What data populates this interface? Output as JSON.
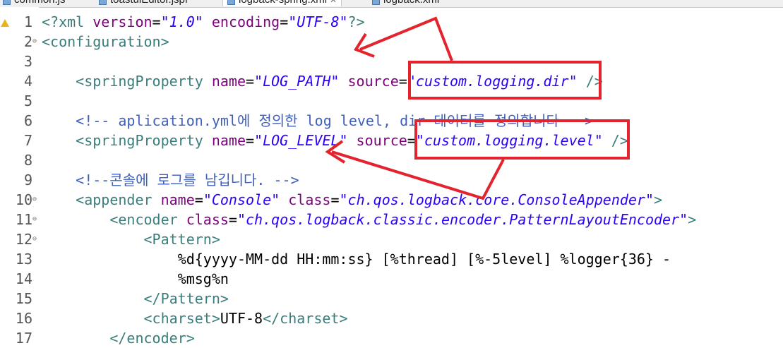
{
  "tabs": [
    {
      "label": "common.js",
      "active": false,
      "icon": "js-file-icon"
    },
    {
      "label": "toastuiEditor.jspf",
      "active": false,
      "icon": "jsp-file-icon"
    },
    {
      "label": "logback-spring.xml",
      "active": true,
      "icon": "xml-file-icon",
      "close": "✕"
    },
    {
      "label": "logback.xml",
      "active": false,
      "icon": "xml-file-icon"
    }
  ],
  "editor": {
    "warning_icon": "warning-icon",
    "lines": [
      {
        "num": "1",
        "fold": "",
        "segs": [
          [
            "tag",
            "<?xml "
          ],
          [
            "attr",
            "version"
          ],
          [
            "txt",
            "="
          ],
          [
            "val",
            "\"1.0\""
          ],
          [
            "txt",
            " "
          ],
          [
            "attr",
            "encoding"
          ],
          [
            "txt",
            "="
          ],
          [
            "val",
            "\"UTF-8\""
          ],
          [
            "tag",
            "?>"
          ]
        ]
      },
      {
        "num": "2",
        "fold": "⊖",
        "segs": [
          [
            "tag",
            "<configuration>"
          ]
        ]
      },
      {
        "num": "3",
        "fold": "",
        "segs": []
      },
      {
        "num": "4",
        "fold": "",
        "segs": [
          [
            "txt",
            "    "
          ],
          [
            "tag",
            "<springProperty "
          ],
          [
            "attr",
            "name"
          ],
          [
            "txt",
            "="
          ],
          [
            "val",
            "\"LOG_PATH\""
          ],
          [
            "txt",
            " "
          ],
          [
            "attr",
            "source"
          ],
          [
            "txt",
            "="
          ],
          [
            "val",
            "\"custom.logging.dir\""
          ],
          [
            "txt",
            " "
          ],
          [
            "tag",
            "/>"
          ]
        ]
      },
      {
        "num": "5",
        "fold": "",
        "segs": []
      },
      {
        "num": "6",
        "fold": "",
        "segs": [
          [
            "txt",
            "    "
          ],
          [
            "cm",
            "<!-- aplication.yml에 정의한 log level, dir 데이터를 정의합니다 -->"
          ]
        ]
      },
      {
        "num": "7",
        "fold": "",
        "segs": [
          [
            "txt",
            "    "
          ],
          [
            "tag",
            "<springProperty "
          ],
          [
            "attr",
            "name"
          ],
          [
            "txt",
            "="
          ],
          [
            "val",
            "\"LOG_LEVEL\""
          ],
          [
            "txt",
            " "
          ],
          [
            "attr",
            "source"
          ],
          [
            "txt",
            "="
          ],
          [
            "val",
            "\"custom.logging.level\""
          ],
          [
            "txt",
            " "
          ],
          [
            "tag",
            "/>"
          ]
        ]
      },
      {
        "num": "8",
        "fold": "",
        "segs": []
      },
      {
        "num": "9",
        "fold": "",
        "segs": [
          [
            "txt",
            "    "
          ],
          [
            "cm",
            "<!--콘솔에 로그를 남깁니다. -->"
          ]
        ]
      },
      {
        "num": "10",
        "fold": "⊖",
        "segs": [
          [
            "txt",
            "    "
          ],
          [
            "tag",
            "<appender "
          ],
          [
            "attr",
            "name"
          ],
          [
            "txt",
            "="
          ],
          [
            "val",
            "\"Console\""
          ],
          [
            "txt",
            " "
          ],
          [
            "attr",
            "class"
          ],
          [
            "txt",
            "="
          ],
          [
            "val",
            "\"ch.qos.logback.core.ConsoleAppender\""
          ],
          [
            "tag",
            ">"
          ]
        ]
      },
      {
        "num": "11",
        "fold": "⊖",
        "segs": [
          [
            "txt",
            "        "
          ],
          [
            "tag",
            "<encoder "
          ],
          [
            "attr",
            "class"
          ],
          [
            "txt",
            "="
          ],
          [
            "val",
            "\"ch.qos.logback.classic.encoder.PatternLayoutEncoder\""
          ],
          [
            "tag",
            ">"
          ]
        ]
      },
      {
        "num": "12",
        "fold": "⊖",
        "segs": [
          [
            "txt",
            "            "
          ],
          [
            "tag",
            "<Pattern>"
          ]
        ]
      },
      {
        "num": "13",
        "fold": "",
        "segs": [
          [
            "txt",
            "                %d{yyyy-MM-dd HH:mm:ss} [%thread] [%-5level] %logger{36} -"
          ]
        ]
      },
      {
        "num": "14",
        "fold": "",
        "segs": [
          [
            "txt",
            "                %msg%n"
          ]
        ]
      },
      {
        "num": "15",
        "fold": "",
        "segs": [
          [
            "txt",
            "            "
          ],
          [
            "tag",
            "</Pattern>"
          ]
        ]
      },
      {
        "num": "16",
        "fold": "",
        "segs": [
          [
            "txt",
            "            "
          ],
          [
            "tag",
            "<charset>"
          ],
          [
            "txt",
            "UTF-8"
          ],
          [
            "tag",
            "</charset>"
          ]
        ]
      },
      {
        "num": "17",
        "fold": "",
        "segs": [
          [
            "txt",
            "        "
          ],
          [
            "tag",
            "</encoder>"
          ]
        ]
      }
    ]
  },
  "colors": {
    "annotation_red": "#e3232e",
    "tag": "#3a7d7c",
    "attribute": "#7f007f",
    "value": "#2a00ff",
    "comment": "#3f5fbf"
  }
}
